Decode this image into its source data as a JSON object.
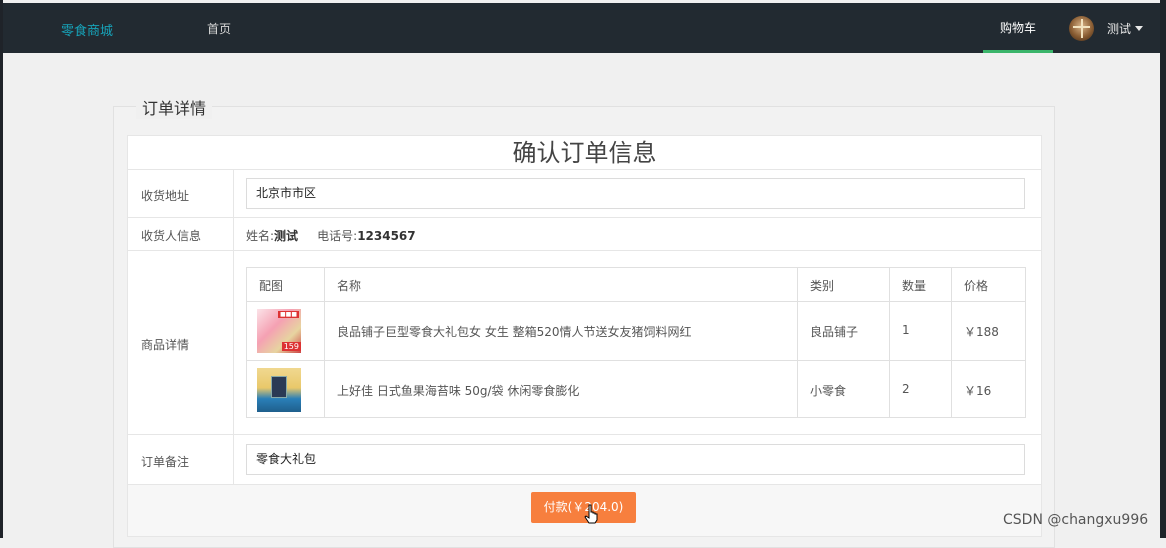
{
  "navbar": {
    "brand": "零食商城",
    "home": "首页",
    "cart": "购物车",
    "user": "测试"
  },
  "panel": {
    "legend": "订单详情",
    "title": "确认订单信息"
  },
  "address": {
    "label": "收货地址",
    "value": "北京市市区"
  },
  "receiver": {
    "label": "收货人信息",
    "name_label": "姓名:",
    "name": "测试",
    "phone_label": "电话号:",
    "phone": "1234567"
  },
  "goods": {
    "label": "商品详情",
    "headers": [
      "配图",
      "名称",
      "类别",
      "数量",
      "价格"
    ],
    "items": [
      {
        "thumb_text": "159",
        "name": "良品铺子巨型零食大礼包女 女生 整箱520情人节送女友猪饲料网红",
        "category": "良品铺子",
        "qty": "1",
        "price": "￥188"
      },
      {
        "name": "上好佳 日式鱼果海苔味 50g/袋 休闲零食膨化",
        "category": "小零食",
        "qty": "2",
        "price": "￥16"
      }
    ]
  },
  "remark": {
    "label": "订单备注",
    "value": "零食大礼包"
  },
  "pay_button": "付款(￥204.0)",
  "watermark": "CSDN @changxu996"
}
